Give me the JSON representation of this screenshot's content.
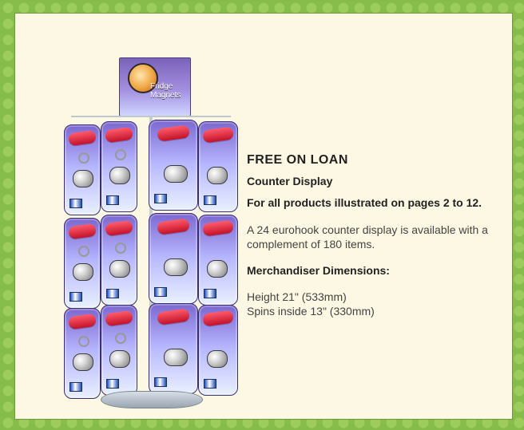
{
  "colors": {
    "frame_green": "#86bc4a",
    "panel_cream": "#fdf8e3",
    "text_dark": "#222222",
    "text_body": "#444444",
    "card_purple": "#7c68d0"
  },
  "product_image": {
    "header": {
      "title_line1": "Fridge",
      "title_line2": "Magnets"
    }
  },
  "copy": {
    "headline": "FREE ON LOAN",
    "subhead": "Counter Display",
    "products_line": "For all products illustrated on pages 2 to 12.",
    "body": "A 24 eurohook counter display is available with a complement of 180 items.",
    "dimensions_heading": "Merchandiser Dimensions:",
    "dimension_lines": [
      "Height 21\" (533mm)",
      "Spins inside 13\" (330mm)"
    ]
  }
}
